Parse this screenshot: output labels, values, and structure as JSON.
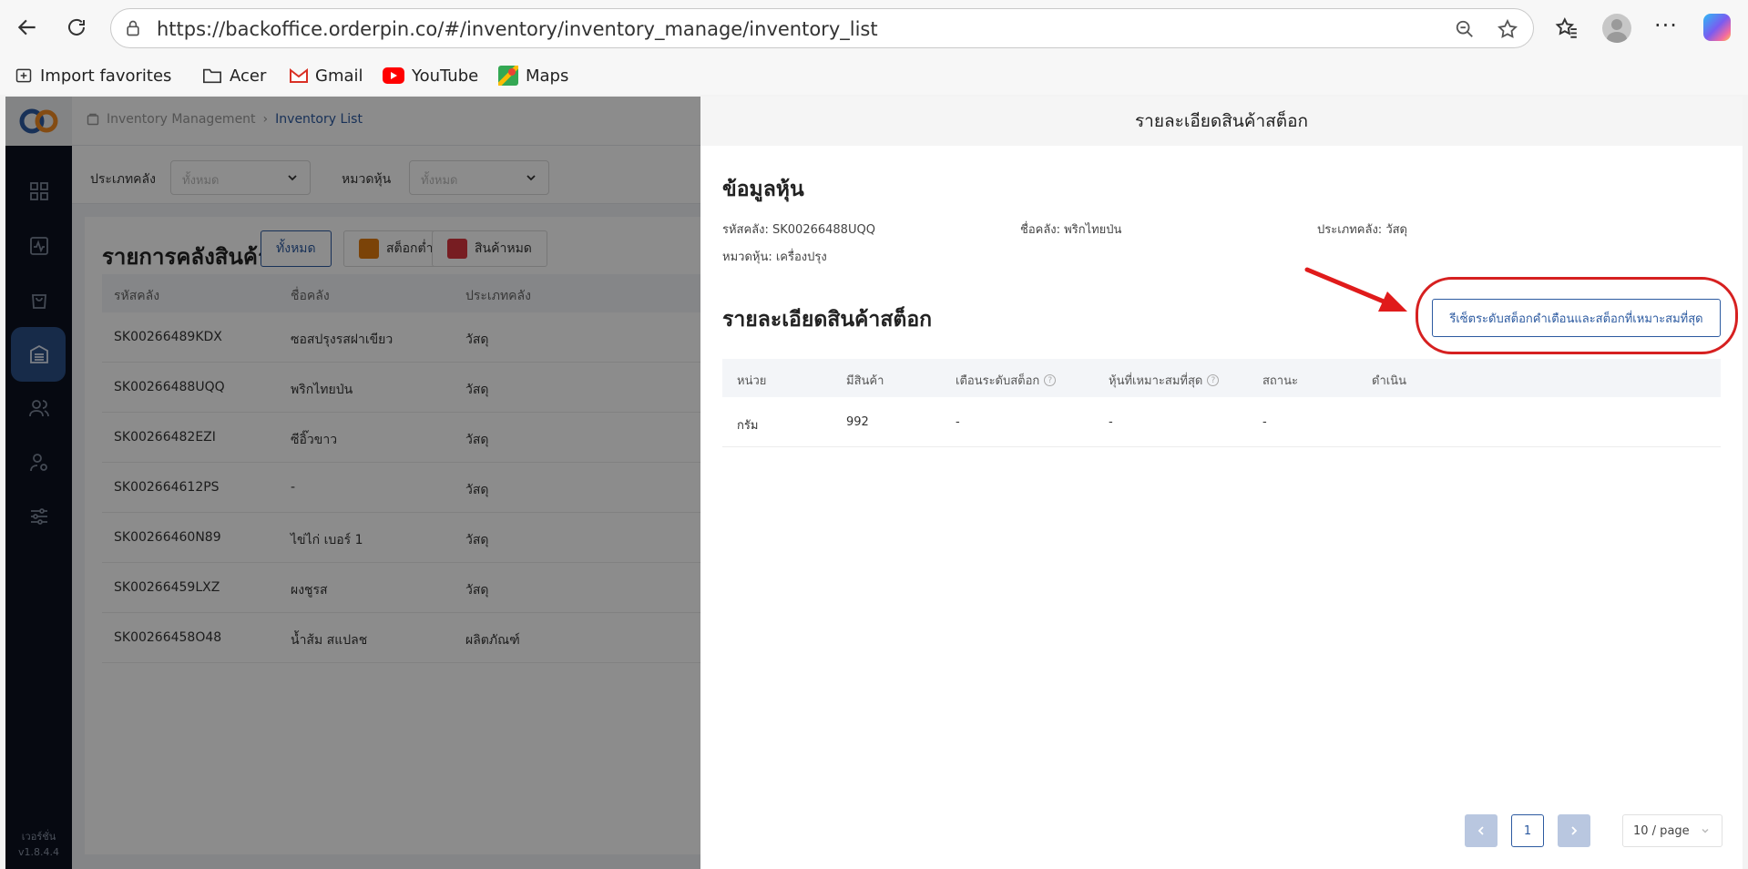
{
  "browser": {
    "url": "https://backoffice.orderpin.co/#/inventory/inventory_manage/inventory_list",
    "bookmarks": [
      "Import favorites",
      "Acer",
      "Gmail",
      "YouTube",
      "Maps"
    ]
  },
  "sidebar": {
    "version_label": "เวอร์ชั่น",
    "version": "v1.8.4.4"
  },
  "breadcrumb": {
    "parent": "Inventory Management",
    "current": "Inventory List"
  },
  "filters": [
    {
      "label": "ประเภทคลัง",
      "value": "ทั้งหมด"
    },
    {
      "label": "หมวดหุ้น",
      "value": "ทั้งหมด"
    }
  ],
  "list": {
    "title": "รายการคลังสินค้า",
    "filter_all": "ทั้งหมด",
    "filter_low": "สต็อกต่ำ",
    "filter_out": "สินค้าหมด",
    "columns": [
      "รหัสคลัง",
      "ชื่อคลัง",
      "ประเภทคลัง"
    ],
    "rows": [
      [
        "SK00266489KDX",
        "ซอสปรุงรสฝาเขียว",
        "วัสดุ"
      ],
      [
        "SK00266488UQQ",
        "พริกไทยป่น",
        "วัสดุ"
      ],
      [
        "SK00266482EZI",
        "ซีอิ๊วขาว",
        "วัสดุ"
      ],
      [
        "SK002664612PS",
        "-",
        "วัสดุ"
      ],
      [
        "SK00266460N89",
        "ไข่ไก่ เบอร์ 1",
        "วัสดุ"
      ],
      [
        "SK00266459LXZ",
        "ผงชูรส",
        "วัสดุ"
      ],
      [
        "SK00266458O48",
        "น้ำส้ม สแปลช",
        "ผลิตภัณฑ์"
      ]
    ],
    "colors": {
      "low": "#e07b0f",
      "out": "#d9363e"
    }
  },
  "drawer": {
    "title": "รายละเอียดสินค้าสต็อก",
    "info_title": "ข้อมูลหุ้น",
    "code": "รหัสคลัง: SK00266488UQQ",
    "name": "ชื่อคลัง: พริกไทยป่น",
    "type": "ประเภทคลัง: วัสดุ",
    "category": "หมวดหุ้น: เครื่องปรุง",
    "stock_title": "รายละเอียดสินค้าสต็อก",
    "reset_button": "รีเซ็ตระดับสต็อกคำเตือนและสต็อกที่เหมาะสมที่สุด",
    "stock_columns": [
      "หน่วย",
      "มีสินค้า",
      "เตือนระดับสต็อก",
      "หุ้นที่เหมาะสมที่สุด",
      "สถานะ",
      "ดำเนิน"
    ],
    "stock_row": [
      "กรัม",
      "992",
      "-",
      "-",
      "-"
    ],
    "pagination": {
      "page": "1",
      "page_size": "10 / page"
    }
  }
}
